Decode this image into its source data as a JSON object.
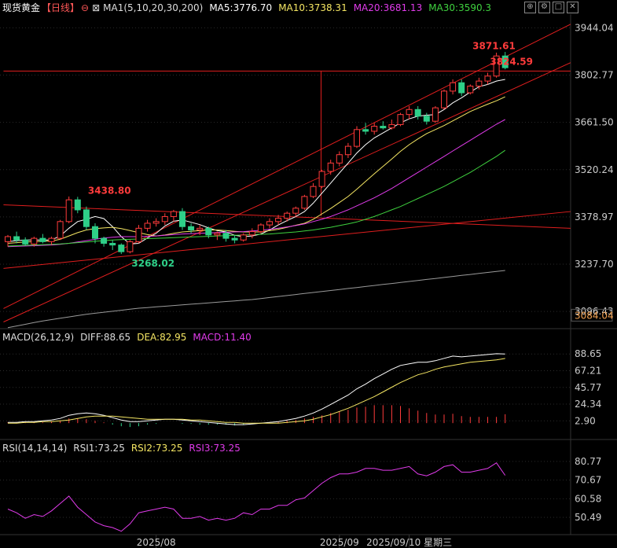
{
  "instrument": {
    "name": "现货黄金",
    "period": "【日线】",
    "icon": "settings-circle-icon"
  },
  "main_legend": {
    "ma1": "MA1(5,10,20,30,200)",
    "ma5": "MA5:3776.70",
    "ma10": "MA10:3738.31",
    "ma20": "MA20:3681.13",
    "ma30": "MA30:3590.3"
  },
  "macd_legend": {
    "title": "MACD(26,12,9)",
    "diff": "DIFF:88.65",
    "dea": "DEA:82.95",
    "macd": "MACD:11.40"
  },
  "rsi_legend": {
    "title": "RSI(14,14,14)",
    "rsi1": "RSI1:73.25",
    "rsi2": "RSI2:73.25",
    "rsi3": "RSI3:73.25"
  },
  "window_buttons": [
    "restore-icon",
    "settings-icon",
    "maximize-icon",
    "close-icon"
  ],
  "colors": {
    "up": "#ff3b3b",
    "down": "#2ecf88",
    "ma5": "#ffffff",
    "ma10": "#f5e663",
    "ma20": "#e03bea",
    "ma30": "#3fd23f",
    "ma200": "#9a9a9a",
    "bg": "#000000",
    "grid": "#2a2a2a",
    "trend": "#e01e1e",
    "axis_text": "#cccccc"
  },
  "chart_data": [
    {
      "type": "candlestick",
      "name": "main",
      "ylim": [
        3045,
        3985
      ],
      "y_ticks": [
        "3944.04",
        "3802.77",
        "3661.50",
        "3520.24",
        "3378.97",
        "3237.70",
        "3096.43"
      ],
      "y_ticks_highlight": [
        "3084.04"
      ],
      "grid": true,
      "annotations": [
        {
          "label": "3871.61",
          "x": 58,
          "y": 3871.61,
          "color": "up"
        },
        {
          "label": "3824.59",
          "x": 60,
          "y": 3824.59,
          "color": "up"
        },
        {
          "label": "3438.80",
          "x": 9,
          "y": 3438.8,
          "color": "up"
        },
        {
          "label": "3268.02",
          "x": 14,
          "y": 3268.02,
          "color": "down"
        }
      ],
      "x_labels": [
        {
          "x": 17,
          "label": "2025/08"
        },
        {
          "x": 38,
          "label": "2025/09"
        },
        {
          "x": 46,
          "label": "2025/09/10 星期三"
        }
      ],
      "candles": [
        [
          3305,
          3325,
          3290,
          3320
        ],
        [
          3320,
          3335,
          3300,
          3310
        ],
        [
          3310,
          3318,
          3292,
          3298
        ],
        [
          3298,
          3320,
          3290,
          3315
        ],
        [
          3315,
          3328,
          3300,
          3305
        ],
        [
          3305,
          3320,
          3295,
          3315
        ],
        [
          3315,
          3370,
          3310,
          3365
        ],
        [
          3365,
          3440,
          3360,
          3430
        ],
        [
          3430,
          3439,
          3390,
          3400
        ],
        [
          3400,
          3410,
          3340,
          3350
        ],
        [
          3350,
          3360,
          3300,
          3315
        ],
        [
          3315,
          3320,
          3290,
          3300
        ],
        [
          3300,
          3310,
          3280,
          3295
        ],
        [
          3295,
          3300,
          3268,
          3275
        ],
        [
          3275,
          3310,
          3270,
          3305
        ],
        [
          3305,
          3355,
          3300,
          3345
        ],
        [
          3345,
          3370,
          3335,
          3360
        ],
        [
          3360,
          3375,
          3350,
          3365
        ],
        [
          3365,
          3390,
          3355,
          3380
        ],
        [
          3380,
          3400,
          3365,
          3395
        ],
        [
          3395,
          3405,
          3340,
          3350
        ],
        [
          3350,
          3360,
          3330,
          3340
        ],
        [
          3340,
          3355,
          3325,
          3345
        ],
        [
          3345,
          3350,
          3315,
          3325
        ],
        [
          3325,
          3335,
          3310,
          3330
        ],
        [
          3330,
          3340,
          3305,
          3315
        ],
        [
          3315,
          3325,
          3300,
          3310
        ],
        [
          3310,
          3330,
          3305,
          3325
        ],
        [
          3325,
          3345,
          3315,
          3335
        ],
        [
          3335,
          3360,
          3330,
          3355
        ],
        [
          3355,
          3375,
          3345,
          3365
        ],
        [
          3365,
          3385,
          3355,
          3375
        ],
        [
          3375,
          3395,
          3365,
          3390
        ],
        [
          3390,
          3410,
          3380,
          3405
        ],
        [
          3405,
          3445,
          3400,
          3440
        ],
        [
          3440,
          3480,
          3435,
          3470
        ],
        [
          3470,
          3520,
          3465,
          3515
        ],
        [
          3515,
          3550,
          3505,
          3540
        ],
        [
          3540,
          3575,
          3530,
          3565
        ],
        [
          3565,
          3600,
          3555,
          3590
        ],
        [
          3590,
          3650,
          3585,
          3640
        ],
        [
          3640,
          3660,
          3625,
          3635
        ],
        [
          3635,
          3660,
          3625,
          3650
        ],
        [
          3650,
          3665,
          3640,
          3645
        ],
        [
          3645,
          3670,
          3640,
          3655
        ],
        [
          3655,
          3690,
          3650,
          3685
        ],
        [
          3685,
          3710,
          3670,
          3700
        ],
        [
          3700,
          3710,
          3670,
          3680
        ],
        [
          3680,
          3690,
          3655,
          3665
        ],
        [
          3665,
          3710,
          3660,
          3705
        ],
        [
          3705,
          3760,
          3700,
          3755
        ],
        [
          3755,
          3790,
          3745,
          3780
        ],
        [
          3780,
          3790,
          3740,
          3750
        ],
        [
          3750,
          3775,
          3745,
          3770
        ],
        [
          3770,
          3795,
          3760,
          3785
        ],
        [
          3785,
          3810,
          3775,
          3800
        ],
        [
          3800,
          3870,
          3795,
          3860
        ],
        [
          3860,
          3872,
          3820,
          3825
        ]
      ],
      "series": [
        {
          "name": "MA5",
          "color_key": "ma5",
          "values": [
            3305,
            3308,
            3310,
            3310,
            3310,
            3310,
            3322,
            3345,
            3365,
            3372,
            3380,
            3374,
            3350,
            3320,
            3298,
            3300,
            3316,
            3330,
            3352,
            3366,
            3370,
            3363,
            3356,
            3346,
            3338,
            3334,
            3324,
            3320,
            3322,
            3328,
            3340,
            3355,
            3368,
            3380,
            3395,
            3420,
            3450,
            3480,
            3510,
            3540,
            3570,
            3595,
            3615,
            3630,
            3645,
            3660,
            3672,
            3680,
            3683,
            3685,
            3700,
            3720,
            3735,
            3752,
            3768,
            3775,
            3785,
            3790
          ]
        },
        {
          "name": "MA10",
          "color_key": "ma10",
          "values": [
            3300,
            3302,
            3304,
            3305,
            3306,
            3307,
            3312,
            3322,
            3332,
            3340,
            3344,
            3346,
            3348,
            3344,
            3338,
            3332,
            3326,
            3322,
            3325,
            3330,
            3334,
            3336,
            3338,
            3340,
            3340,
            3338,
            3336,
            3334,
            3334,
            3334,
            3338,
            3342,
            3348,
            3354,
            3360,
            3372,
            3388,
            3404,
            3422,
            3440,
            3462,
            3485,
            3508,
            3530,
            3552,
            3575,
            3595,
            3612,
            3628,
            3640,
            3652,
            3666,
            3680,
            3694,
            3705,
            3716,
            3726,
            3738
          ]
        },
        {
          "name": "MA20",
          "color_key": "ma20",
          "values": [
            3290,
            3291,
            3292,
            3293,
            3294,
            3295,
            3297,
            3300,
            3304,
            3308,
            3312,
            3316,
            3318,
            3320,
            3320,
            3320,
            3321,
            3322,
            3324,
            3326,
            3328,
            3329,
            3330,
            3331,
            3332,
            3333,
            3334,
            3335,
            3337,
            3339,
            3342,
            3345,
            3349,
            3353,
            3358,
            3365,
            3372,
            3380,
            3390,
            3400,
            3412,
            3424,
            3436,
            3450,
            3464,
            3480,
            3496,
            3512,
            3528,
            3544,
            3560,
            3576,
            3592,
            3608,
            3624,
            3640,
            3656,
            3670
          ]
        },
        {
          "name": "MA30",
          "color_key": "ma30",
          "values": [
            3292,
            3293,
            3294,
            3295,
            3296,
            3297,
            3298,
            3300,
            3302,
            3304,
            3306,
            3308,
            3310,
            3311,
            3312,
            3313,
            3314,
            3315,
            3316,
            3317,
            3318,
            3319,
            3320,
            3321,
            3322,
            3323,
            3324,
            3325,
            3326,
            3327,
            3328,
            3330,
            3332,
            3334,
            3337,
            3340,
            3344,
            3348,
            3353,
            3358,
            3364,
            3372,
            3380,
            3390,
            3400,
            3410,
            3422,
            3434,
            3446,
            3458,
            3470,
            3484,
            3498,
            3512,
            3528,
            3544,
            3560,
            3578
          ]
        },
        {
          "name": "MA200",
          "color_key": "ma200",
          "values": [
            3048,
            3053,
            3058,
            3063,
            3068,
            3072,
            3076,
            3080,
            3084,
            3088,
            3091,
            3094,
            3097,
            3100,
            3103,
            3106,
            3108,
            3110,
            3112,
            3114,
            3116,
            3118,
            3120,
            3122,
            3124,
            3126,
            3128,
            3130,
            3132,
            3135,
            3138,
            3141,
            3144,
            3147,
            3150,
            3153,
            3156,
            3159,
            3162,
            3165,
            3168,
            3171,
            3174,
            3177,
            3180,
            3183,
            3186,
            3189,
            3192,
            3195,
            3198,
            3201,
            3204,
            3207,
            3210,
            3213,
            3216,
            3219
          ]
        }
      ],
      "trendlines": [
        {
          "x": [
            -0.5,
            64.5
          ],
          "y": [
            3105,
            3955
          ]
        },
        {
          "x": [
            -0.5,
            64.5
          ],
          "y": [
            3065,
            3840
          ]
        },
        {
          "x": [
            -0.5,
            64.5
          ],
          "y": [
            3415,
            3345
          ]
        },
        {
          "x": [
            -0.5,
            64.5
          ],
          "y": [
            3225,
            3395
          ]
        },
        {
          "x": [
            -0.5,
            64.5
          ],
          "y": [
            3815,
            3815
          ]
        },
        {
          "x": [
            35.9,
            35.9
          ],
          "y": [
            3815,
            3382
          ]
        }
      ]
    },
    {
      "type": "bar+line",
      "name": "macd",
      "ylim": [
        -20,
        102
      ],
      "y_ticks": [
        "88.65",
        "67.21",
        "45.77",
        "24.34",
        "2.90"
      ],
      "series": [
        {
          "name": "DIFF",
          "color_key": "ma5",
          "values": [
            1,
            1,
            2,
            2,
            3,
            4,
            6,
            10,
            12,
            13,
            12,
            10,
            7,
            4,
            2,
            2,
            3,
            4,
            5,
            5,
            4,
            3,
            2,
            1,
            0,
            -1,
            -2,
            -2,
            -1,
            0,
            1,
            2,
            4,
            6,
            9,
            13,
            18,
            24,
            30,
            36,
            44,
            50,
            57,
            63,
            69,
            74,
            76,
            78,
            78,
            80,
            83,
            86,
            85,
            86,
            87,
            88,
            89,
            88.65
          ]
        },
        {
          "name": "DEA",
          "color_key": "ma10",
          "values": [
            0,
            0,
            1,
            1,
            2,
            2,
            3,
            4,
            6,
            8,
            9,
            9,
            9,
            8,
            7,
            6,
            5,
            5,
            5,
            5,
            5,
            4,
            4,
            3,
            2,
            1,
            1,
            0,
            0,
            0,
            0,
            0,
            1,
            2,
            3,
            5,
            8,
            11,
            15,
            19,
            24,
            29,
            34,
            40,
            46,
            52,
            57,
            62,
            65,
            69,
            72,
            74,
            76,
            78,
            79,
            80,
            81,
            82.95
          ]
        },
        {
          "name": "MACD",
          "color_key": "up",
          "values": [
            1,
            1,
            1,
            1,
            1,
            2,
            3,
            6,
            6,
            5,
            3,
            1,
            -2,
            -4,
            -5,
            -4,
            -2,
            -1,
            0,
            0,
            -1,
            -1,
            -2,
            -2,
            -2,
            -2,
            -3,
            -2,
            -1,
            0,
            1,
            2,
            3,
            4,
            6,
            8,
            10,
            13,
            15,
            17,
            20,
            21,
            23,
            23,
            23,
            22,
            19,
            16,
            13,
            11,
            11,
            12,
            9,
            8,
            8,
            8,
            8,
            11.4
          ]
        }
      ]
    },
    {
      "type": "line",
      "name": "rsi",
      "ylim": [
        42,
        85
      ],
      "y_ticks": [
        "80.77",
        "70.67",
        "60.58",
        "50.49"
      ],
      "series": [
        {
          "name": "RSI1",
          "color_key": "ma20",
          "values": [
            55,
            53,
            50,
            52,
            51,
            54,
            58,
            62,
            56,
            52,
            48,
            46,
            45,
            43,
            47,
            53,
            54,
            55,
            56,
            55,
            50,
            50,
            51,
            49,
            50,
            49,
            50,
            53,
            52,
            55,
            55,
            57,
            57,
            60,
            61,
            65,
            69,
            72,
            74,
            74,
            75,
            77,
            77,
            76,
            76,
            77,
            78,
            74,
            73,
            75,
            78,
            79,
            75,
            75,
            76,
            77,
            80,
            73.25
          ]
        }
      ]
    }
  ]
}
